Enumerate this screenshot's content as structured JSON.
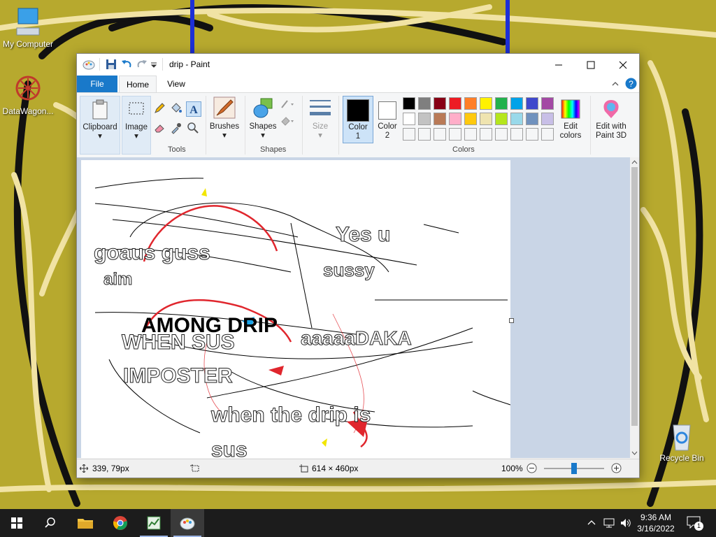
{
  "desktop": {
    "icons": [
      {
        "label": "My Computer"
      },
      {
        "label": "DataWagon..."
      },
      {
        "label": "Recycle Bin"
      }
    ]
  },
  "window": {
    "title": "drip - Paint",
    "tabs": {
      "file": "File",
      "home": "Home",
      "view": "View"
    }
  },
  "ribbon": {
    "clipboard": "Clipboard",
    "image": "Image",
    "tools": "Tools",
    "brushes": "Brushes",
    "shapes_button": "Shapes",
    "shapes_group": "Shapes",
    "size": "Size",
    "color1_l1": "Color",
    "color1_l2": "1",
    "color2_l1": "Color",
    "color2_l2": "2",
    "edit_colors_l1": "Edit",
    "edit_colors_l2": "colors",
    "colors_group": "Colors",
    "paint3d_l1": "Edit with",
    "paint3d_l2": "Paint 3D",
    "palette_row1": [
      "#000000",
      "#7f7f7f",
      "#880015",
      "#ed1c24",
      "#ff7f27",
      "#fff200",
      "#22b14c",
      "#00a2e8",
      "#3f48cc",
      "#a349a4"
    ],
    "palette_row2": [
      "#ffffff",
      "#c3c3c3",
      "#b97a57",
      "#ffaec9",
      "#ffc90e",
      "#efe4b0",
      "#b5e61d",
      "#99d9ea",
      "#7092be",
      "#c8bfe7"
    ]
  },
  "drawing_text": {
    "t1": "goaus guss",
    "t2": "Yes u",
    "t3": "aim",
    "t4": "sussy",
    "t5": "AMONG DRIP",
    "t6": "WHEN SUS",
    "t7": "aaaaaDAKA",
    "t8": "IMPOSTER",
    "t9": "when the drip is",
    "t10": "sus"
  },
  "status": {
    "cursor_pos": "339, 79px",
    "canvas_size": "614 × 460px",
    "zoom": "100%"
  },
  "taskbar": {
    "time": "9:36 AM",
    "date": "3/16/2022",
    "notification_count": "1"
  },
  "colors": {
    "accent": "#1979ca",
    "wallpaper": "#b7a92e"
  }
}
